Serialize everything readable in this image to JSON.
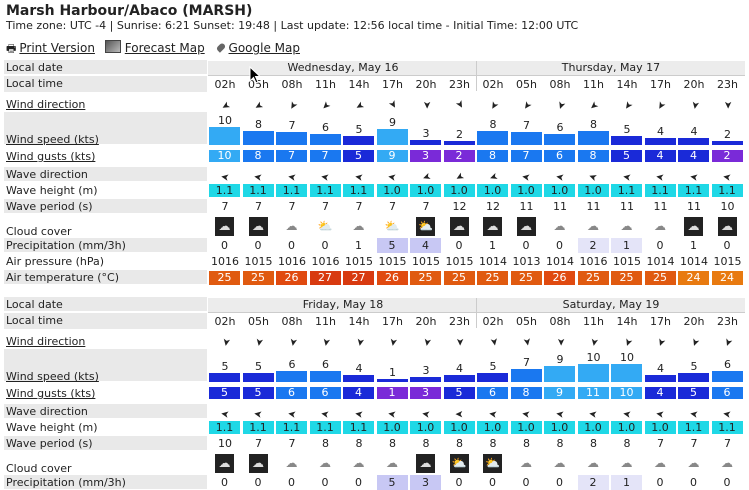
{
  "header": {
    "title": "Marsh Harbour/Abaco (MARSH)",
    "info": "Time zone: UTC -4 | Sunrise: 6:21 Sunset: 19:48 | Last update: 12:56 local time - Initial Time: 12:00 UTC"
  },
  "links": {
    "print": "Print Version",
    "forecast_map": "Forecast Map",
    "google_map": "Google Map"
  },
  "labels": {
    "local_date": "Local date",
    "local_time": "Local time",
    "wind_direction": "Wind direction",
    "wind_speed": "Wind speed (kts)",
    "wind_gusts": "Wind gusts (kts)",
    "wave_direction": "Wave direction",
    "wave_height": "Wave height (m)",
    "wave_period": "Wave period (s)",
    "cloud_cover": "Cloud cover",
    "precipitation": "Precipitation (mm/3h)",
    "air_pressure": "Air pressure (hPa)",
    "air_temperature": "Air temperature (°C)"
  },
  "block1": {
    "days": [
      "Wednesday, May 16",
      "Thursday, May 17"
    ],
    "times": [
      "02h",
      "05h",
      "08h",
      "11h",
      "14h",
      "17h",
      "20h",
      "23h",
      "02h",
      "05h",
      "08h",
      "11h",
      "14h",
      "17h",
      "20h",
      "23h"
    ],
    "wind_dir_deg": [
      150,
      150,
      120,
      135,
      150,
      60,
      90,
      60,
      120,
      125,
      110,
      140,
      125,
      120,
      100,
      90
    ],
    "wind_speed": [
      "10",
      "8",
      "7",
      "6",
      "5",
      "9",
      "3",
      "2",
      "8",
      "7",
      "6",
      "8",
      "5",
      "4",
      "4",
      "2"
    ],
    "wind_gusts": [
      "10",
      "8",
      "7",
      "7",
      "5",
      "9",
      "3",
      "2",
      "8",
      "7",
      "6",
      "8",
      "5",
      "4",
      "4",
      "2"
    ],
    "wave_dir_deg": [
      100,
      100,
      100,
      100,
      100,
      100,
      70,
      60,
      70,
      100,
      100,
      110,
      100,
      100,
      100,
      100
    ],
    "wave_height": [
      "1.1",
      "1.1",
      "1.1",
      "1.1",
      "1.1",
      "1.0",
      "1.0",
      "1.0",
      "1.0",
      "1.0",
      "1.0",
      "1.0",
      "1.1",
      "1.1",
      "1.1",
      "1.1"
    ],
    "wave_period": [
      "7",
      "7",
      "7",
      "7",
      "7",
      "7",
      "7",
      "12",
      "12",
      "11",
      "11",
      "11",
      "11",
      "11",
      "11",
      "10"
    ],
    "cloud": [
      "cloud",
      "cloud",
      "cloud-light",
      "sun-cloud-light",
      "cloud-light",
      "sun-cloud-light",
      "sun-cloud",
      "cloud",
      "cloud",
      "cloud",
      "cloud-light",
      "cloud-light",
      "cloud-light",
      "cloud-light",
      "cloud",
      "cloud"
    ],
    "precipitation": [
      "0",
      "0",
      "0",
      "0",
      "1",
      "5",
      "4",
      "0",
      "1",
      "0",
      "0",
      "2",
      "1",
      "0",
      "1",
      "0"
    ],
    "pressure": [
      "1016",
      "1015",
      "1016",
      "1016",
      "1015",
      "1015",
      "1015",
      "1015",
      "1014",
      "1013",
      "1014",
      "1016",
      "1015",
      "1014",
      "1014",
      "1015"
    ],
    "temperature": [
      "25",
      "25",
      "26",
      "27",
      "27",
      "26",
      "25",
      "25",
      "25",
      "25",
      "26",
      "25",
      "25",
      "25",
      "24",
      "24"
    ]
  },
  "block2": {
    "days": [
      "Friday, May 18",
      "Saturday, May 19"
    ],
    "times": [
      "02h",
      "05h",
      "08h",
      "11h",
      "14h",
      "17h",
      "20h",
      "23h",
      "02h",
      "05h",
      "08h",
      "11h",
      "14h",
      "17h",
      "20h",
      "23h"
    ],
    "wind_dir_deg": [
      100,
      100,
      100,
      100,
      100,
      100,
      100,
      90,
      80,
      80,
      90,
      100,
      110,
      110,
      110,
      110
    ],
    "wind_speed": [
      "5",
      "5",
      "6",
      "6",
      "4",
      "1",
      "3",
      "4",
      "5",
      "7",
      "9",
      "10",
      "10",
      "4",
      "5",
      "6"
    ],
    "wind_gusts": [
      "5",
      "5",
      "6",
      "6",
      "4",
      "1",
      "3",
      "5",
      "6",
      "8",
      "9",
      "11",
      "10",
      "4",
      "5",
      "6"
    ],
    "wave_dir_deg": [
      100,
      100,
      100,
      100,
      100,
      100,
      100,
      90,
      100,
      100,
      100,
      100,
      100,
      100,
      100,
      100
    ],
    "wave_height": [
      "1.1",
      "1.1",
      "1.1",
      "1.1",
      "1.1",
      "1.0",
      "1.0",
      "1.0",
      "1.0",
      "1.0",
      "1.0",
      "1.0",
      "1.0",
      "1.0",
      "1.1",
      "1.1"
    ],
    "wave_period": [
      "10",
      "7",
      "7",
      "8",
      "8",
      "8",
      "8",
      "8",
      "8",
      "8",
      "8",
      "8",
      "8",
      "7",
      "7",
      "7"
    ],
    "cloud": [
      "cloud",
      "cloud",
      "cloud-light",
      "cloud-light",
      "cloud-light",
      "cloud-light",
      "cloud",
      "sun-cloud",
      "sun-cloud",
      "cloud-light",
      "cloud-light",
      "cloud-light",
      "cloud-light",
      "cloud-light",
      "cloud-light",
      "cloud-light"
    ],
    "precipitation": [
      "0",
      "0",
      "0",
      "0",
      "0",
      "5",
      "3",
      "0",
      "0",
      "0",
      "0",
      "2",
      "1",
      "0",
      "0",
      "0"
    ]
  },
  "colors": {
    "speed_low": "#1a2ad8",
    "speed_mid": "#1a78f0",
    "speed_high": "#33aaf4",
    "gust_purple": "#7a2ad8",
    "wave": "#1fd8e6",
    "temp_24": "#e87a10",
    "temp_25": "#e05a10",
    "temp_26": "#e04a10",
    "temp_27": "#d83a10"
  }
}
